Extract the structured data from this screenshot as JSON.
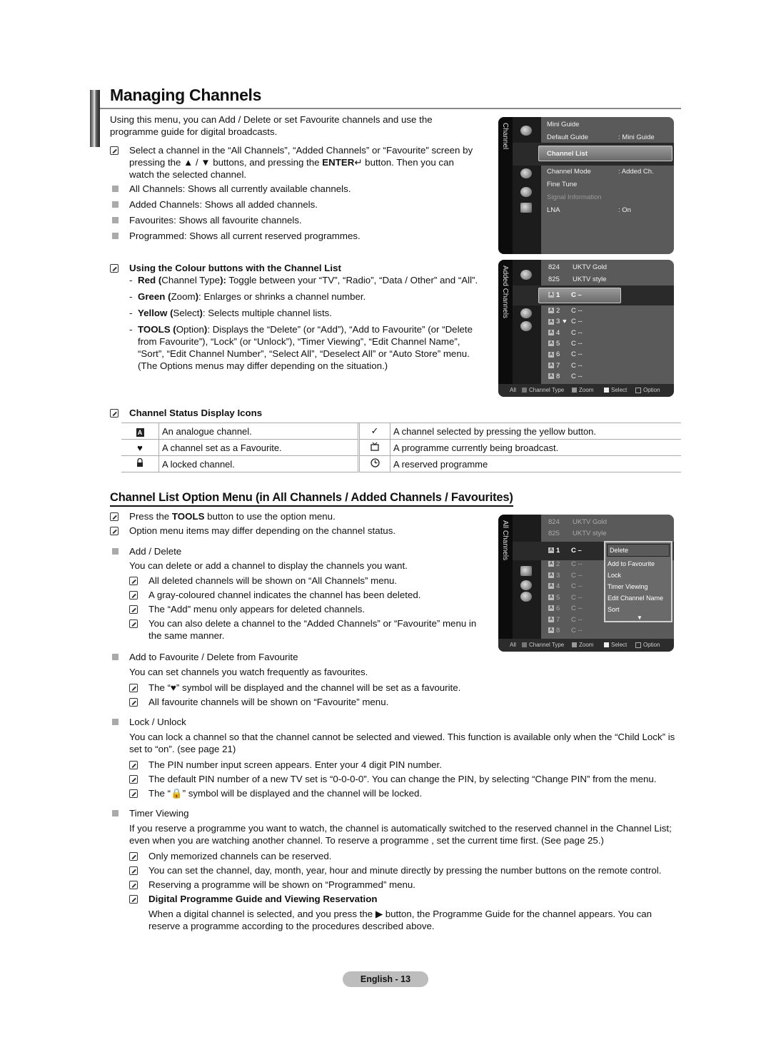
{
  "page": {
    "title": "Managing Channels",
    "intro": "Using this menu, you can Add / Delete or set Favourite channels and use the programme guide for digital broadcasts.",
    "note_select": {
      "part1": "Select a channel in the “All Channels”, “Added Channels” or “Favourite” screen by pressing the ▲ / ▼ buttons, and pressing the ",
      "enter": "ENTER",
      "part2": " button. Then you can watch the selected channel."
    },
    "bullets": [
      "All Channels: Shows all currently available channels.",
      "Added Channels: Shows all added channels.",
      "Favourites: Shows all favourite channels.",
      "Programmed: Shows all current reserved programmes."
    ],
    "colour_buttons": {
      "heading": "Using the Colour buttons with the Channel List",
      "items": [
        {
          "key": "Red (",
          "mid": "Channel Type",
          "key2": "):",
          "text": " Toggle between your “TV”, “Radio”, “Data / Other” and “All”."
        },
        {
          "key": "Green (",
          "mid": "Zoom",
          "key2": ")",
          "text": ": Enlarges or shrinks a channel number."
        },
        {
          "key": "Yellow (",
          "mid": "Select",
          "key2": ")",
          "text": ": Selects multiple channel lists."
        },
        {
          "key": "TOOLS (",
          "mid": "Option",
          "key2": ")",
          "text": ": Displays the “Delete” (or “Add”), “Add to Favourite” (or “Delete from Favourite”), “Lock” (or “Unlock”), “Timer Viewing”, “Edit Channel Name”, “Sort”, “Edit Channel Number”, “Select All”, “Deselect All” or “Auto Store” menu. (The Options menus may differ depending on the situation.)"
        }
      ]
    },
    "status_icons": {
      "heading": "Channel Status Display Icons",
      "rows": [
        {
          "left_icon": "A",
          "left_text": "An analogue channel.",
          "right_icon": "✓",
          "right_text": "A channel selected by pressing the yellow button."
        },
        {
          "left_icon": "♥",
          "left_text": "A channel set as a Favourite.",
          "right_icon": "📺",
          "right_text": "A programme currently being broadcast."
        },
        {
          "left_icon": "🔒",
          "left_text": "A locked channel.",
          "right_icon": "◷",
          "right_text": "A reserved programme"
        }
      ]
    },
    "section2": {
      "heading": "Channel List Option Menu (in All Channels / Added Channels / Favourites)",
      "notes": [
        {
          "pre": "Press the ",
          "bold": "TOOLS",
          "post": " button to use the option menu."
        },
        {
          "pre": "Option menu items may differ depending on the channel status.",
          "bold": "",
          "post": ""
        }
      ],
      "add_delete": {
        "title": "Add / Delete",
        "desc": "You can delete or add a channel to display the channels you want.",
        "notes": [
          "All deleted channels will be shown on “All Channels” menu.",
          "A gray-coloured channel indicates the channel has been deleted.",
          "The “Add” menu only appears for deleted channels.",
          "You can also delete a channel to the “Added Channels” or “Favourite” menu in the same manner."
        ]
      },
      "favourite": {
        "title": "Add to Favourite / Delete from Favourite",
        "desc": "You can set channels you watch frequently as favourites.",
        "notes": [
          "The “♥” symbol will be displayed and the channel will be set as a favourite.",
          "All favourite channels will be shown on “Favourite” menu."
        ]
      },
      "lock": {
        "title": "Lock / Unlock",
        "desc": "You can lock a channel so that the channel cannot be selected and viewed. This function is available only when the “Child Lock” is set to “on”. (see page 21)",
        "notes": [
          "The PIN number input screen appears. Enter your 4 digit PIN number.",
          "The default PIN number of a new TV set is “0-0-0-0”. You can change the PIN, by selecting “Change PIN” from the menu.",
          "The “🔒” symbol will be displayed and the channel will be locked."
        ]
      },
      "timer": {
        "title": "Timer Viewing",
        "desc": "If you reserve a programme you want to watch, the channel is automatically switched to the reserved channel in the Channel List; even when you are watching another channel. To reserve a programme , set the current time first. (See page 25.)",
        "notes": [
          "Only memorized channels can be reserved.",
          "You can set the channel, day, month, year, hour and minute directly by pressing the number buttons on the remote control.",
          "Reserving a programme will be shown on “Programmed” menu."
        ],
        "dpg_heading": "Digital Programme Guide and Viewing Reservation",
        "dpg_text": "When a digital channel is selected, and you press the ▶ button, the Programme Guide for the channel appears. You can reserve a programme according to the procedures described above."
      }
    },
    "page_number": "English - 13"
  },
  "tv_menu1": {
    "side_label": "Channel",
    "items": [
      {
        "label": "Mini Guide",
        "value": ""
      },
      {
        "label": "Default Guide",
        "value": ": Mini Guide"
      },
      {
        "label": "Channel List",
        "value": ""
      },
      {
        "label": "Channel Mode",
        "value": ": Added Ch."
      },
      {
        "label": "Fine Tune",
        "value": ""
      },
      {
        "label": "Signal Information",
        "value": ""
      },
      {
        "label": "LNA",
        "value": ": On"
      }
    ]
  },
  "tv_list_added": {
    "side_label": "Added Channels",
    "top_rows": [
      {
        "num": "824",
        "name": "UKTV Gold"
      },
      {
        "num": "825",
        "name": "UKTV style"
      }
    ],
    "rows": [
      {
        "num": "1",
        "fav": "",
        "name": "C –"
      },
      {
        "num": "2",
        "fav": "",
        "name": "C --"
      },
      {
        "num": "3",
        "fav": "♥",
        "name": "C --"
      },
      {
        "num": "4",
        "fav": "",
        "name": "C --"
      },
      {
        "num": "5",
        "fav": "",
        "name": "C --"
      },
      {
        "num": "6",
        "fav": "",
        "name": "C --"
      },
      {
        "num": "7",
        "fav": "",
        "name": "C --"
      },
      {
        "num": "8",
        "fav": "",
        "name": "C --"
      }
    ],
    "footer": {
      "all": "All",
      "channel_type": "Channel Type",
      "zoom": "Zoom",
      "select": "Select",
      "option": "Option"
    }
  },
  "tv_list_all": {
    "side_label": "All Channels",
    "top_rows": [
      {
        "num": "824",
        "name": "UKTV Gold"
      },
      {
        "num": "825",
        "name": "UKTV style"
      }
    ],
    "rows": [
      {
        "num": "1",
        "name": "C –"
      },
      {
        "num": "2",
        "name": "C --"
      },
      {
        "num": "3",
        "name": "C --"
      },
      {
        "num": "4",
        "name": "C --"
      },
      {
        "num": "5",
        "name": "C --"
      },
      {
        "num": "6",
        "name": "C --"
      },
      {
        "num": "7",
        "name": "C --"
      },
      {
        "num": "8",
        "name": "C --"
      }
    ],
    "popup": [
      "Delete",
      "Add to Favourite",
      "Lock",
      "Timer Viewing",
      "Edit Channel Name",
      "Sort"
    ],
    "footer": {
      "all": "All",
      "channel_type": "Channel Type",
      "zoom": "Zoom",
      "select": "Select",
      "option": "Option"
    }
  }
}
